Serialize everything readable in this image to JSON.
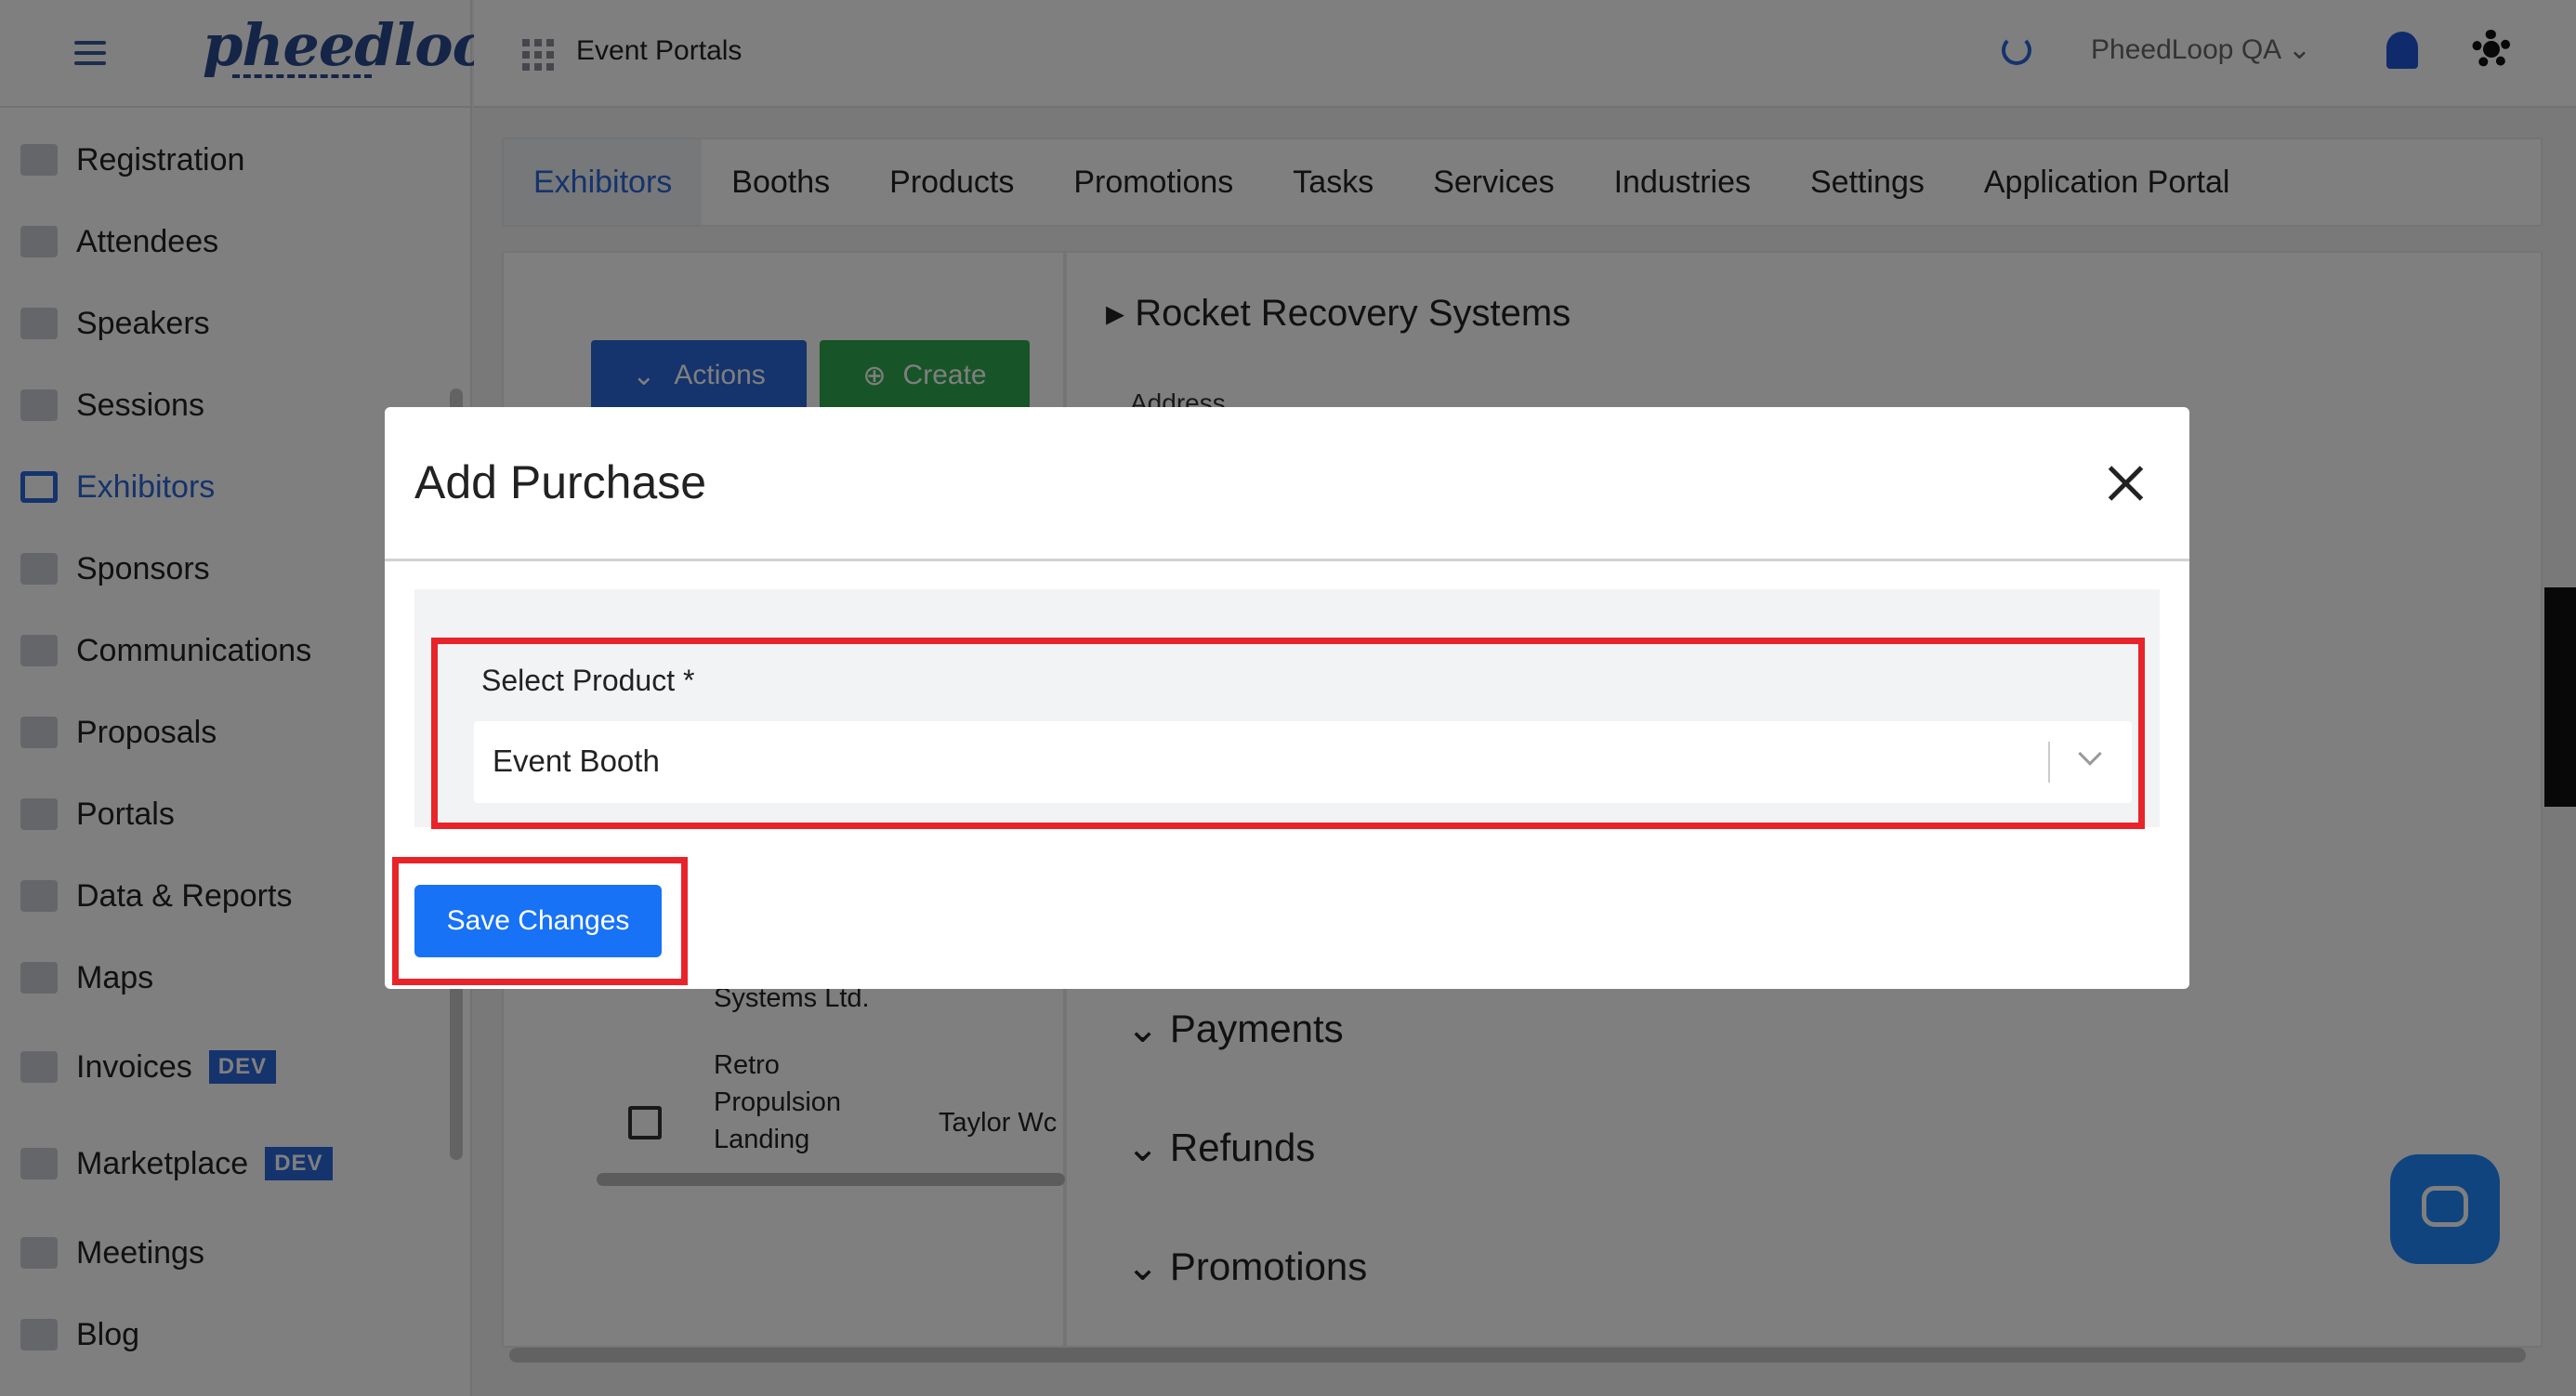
{
  "sidebar": {
    "logo": "pheedloop",
    "items": [
      {
        "label": "Registration",
        "icon": "cart-icon"
      },
      {
        "label": "Attendees",
        "icon": "people-icon"
      },
      {
        "label": "Speakers",
        "icon": "presenter-icon"
      },
      {
        "label": "Sessions",
        "icon": "monitor-icon"
      },
      {
        "label": "Exhibitors",
        "icon": "storefront-icon",
        "active": true
      },
      {
        "label": "Sponsors",
        "icon": "badge-icon"
      },
      {
        "label": "Communications",
        "icon": "mail-icon"
      },
      {
        "label": "Proposals",
        "icon": "document-icon"
      },
      {
        "label": "Portals",
        "icon": "globe-icon"
      },
      {
        "label": "Data & Reports",
        "icon": "chart-icon"
      },
      {
        "label": "Maps",
        "icon": "map-icon"
      },
      {
        "label": "Invoices",
        "icon": "invoice-icon",
        "badge": "DEV"
      },
      {
        "label": "Marketplace",
        "icon": "cart-icon",
        "badge": "DEV"
      },
      {
        "label": "Meetings",
        "icon": "calendar-icon"
      },
      {
        "label": "Blog",
        "icon": "document-icon"
      }
    ]
  },
  "topbar": {
    "title": "Event Portals",
    "account": "PheedLoop QA"
  },
  "tabs": [
    "Exhibitors",
    "Booths",
    "Products",
    "Promotions",
    "Tasks",
    "Services",
    "Industries",
    "Settings",
    "Application Portal"
  ],
  "toolbar": {
    "actions_label": "Actions",
    "create_label": "Create"
  },
  "detail": {
    "company": "Rocket Recovery Systems",
    "address_label": "Address",
    "sections": [
      "Payments",
      "Refunds",
      "Promotions"
    ]
  },
  "list": {
    "row1_text": "Systems Ltd.",
    "row2_lines": [
      "Retro",
      "Propulsion",
      "Landing"
    ],
    "row2_contact": "Taylor Wc"
  },
  "modal": {
    "title": "Add Purchase",
    "field_label": "Select Product *",
    "selected_product": "Event Booth",
    "save_label": "Save Changes"
  },
  "colors": {
    "accent": "#2a66d9",
    "create": "#2fa84f",
    "highlight": "#e8242a",
    "primary_button": "#1772f5"
  }
}
